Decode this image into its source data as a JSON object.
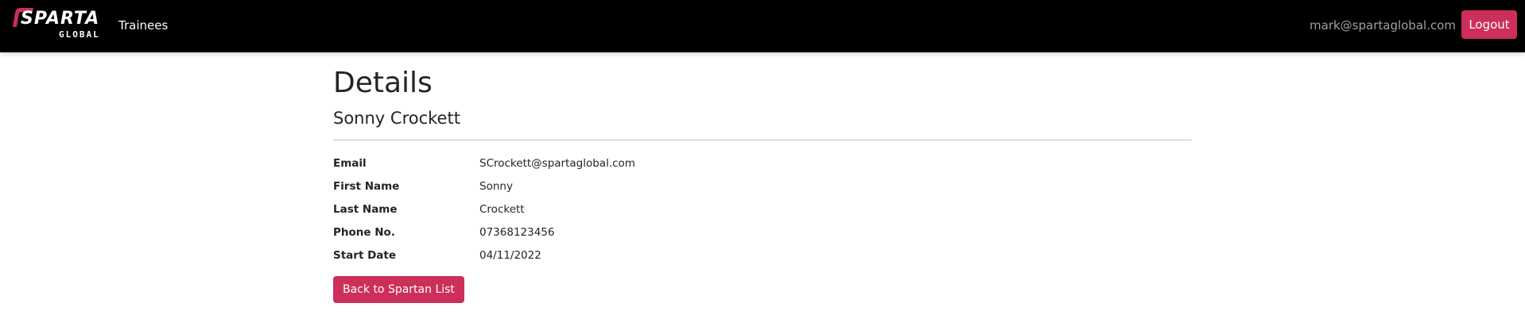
{
  "navbar": {
    "brand": {
      "primary": "SPARTA",
      "secondary": "GLOBAL",
      "icon": "sparta-swoosh-logo"
    },
    "links": [
      {
        "label": "Trainees"
      }
    ],
    "user_email": "mark@spartaglobal.com",
    "logout_label": "Logout"
  },
  "main": {
    "title": "Details",
    "subtitle": "Sonny Crockett",
    "details": [
      {
        "label": "Email",
        "value": "SCrockett@spartaglobal.com"
      },
      {
        "label": "First Name",
        "value": "Sonny"
      },
      {
        "label": "Last Name",
        "value": "Crockett"
      },
      {
        "label": "Phone No.",
        "value": "07368123456"
      },
      {
        "label": "Start Date",
        "value": "04/11/2022"
      }
    ],
    "back_label": "Back to Spartan List"
  },
  "colors": {
    "navbar_bg": "#000000",
    "accent": "#cc2f5a",
    "muted_text": "#9aa0a6",
    "body_text": "#212529"
  }
}
